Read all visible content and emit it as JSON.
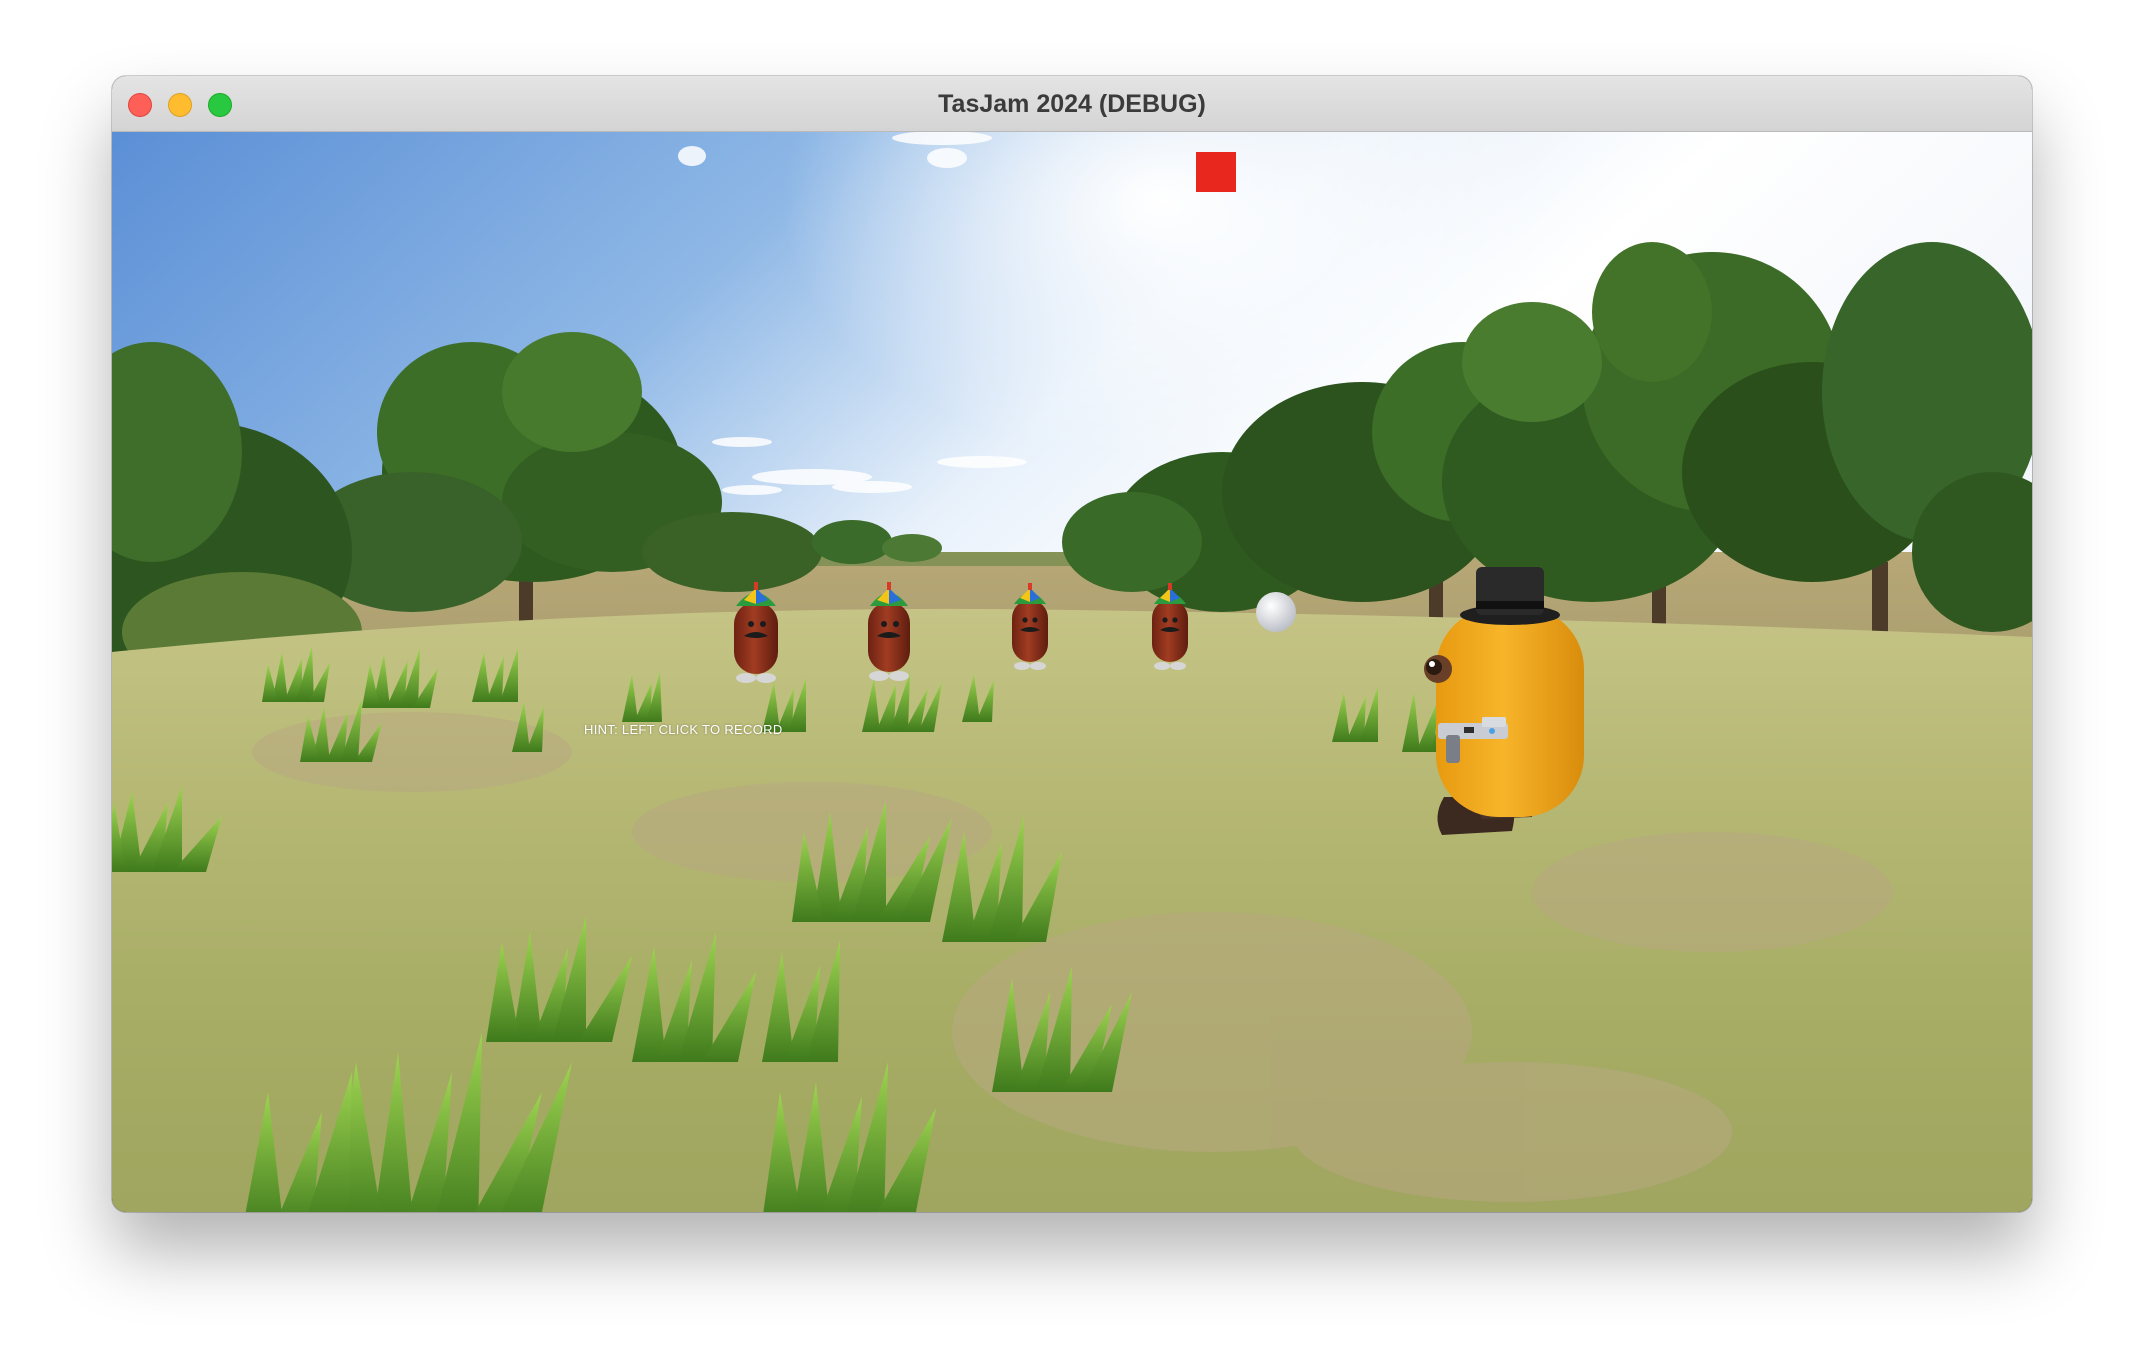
{
  "window": {
    "title": "TasJam 2024 (DEBUG)"
  },
  "hud": {
    "hint": "HINT: LEFT CLICK TO RECORD",
    "record_indicator_color": "#e8281e"
  },
  "scene": {
    "enemies": [
      {
        "type": "sausage-enemy",
        "hat": "propeller-beanie"
      },
      {
        "type": "sausage-enemy",
        "hat": "propeller-beanie"
      },
      {
        "type": "sausage-enemy",
        "hat": "propeller-beanie"
      },
      {
        "type": "sausage-enemy",
        "hat": "propeller-beanie"
      }
    ],
    "player": {
      "type": "yellow-capsule-character",
      "hat": "top-hat",
      "holding": "gun"
    },
    "projectile": "white-ball",
    "colors": {
      "sky_top": "#5f93d8",
      "sky_bright": "#fbfcff",
      "ground": "#a9b26a",
      "grass": "#79b62f",
      "player": "#f2a519",
      "enemy": "#8a2e1a"
    }
  }
}
